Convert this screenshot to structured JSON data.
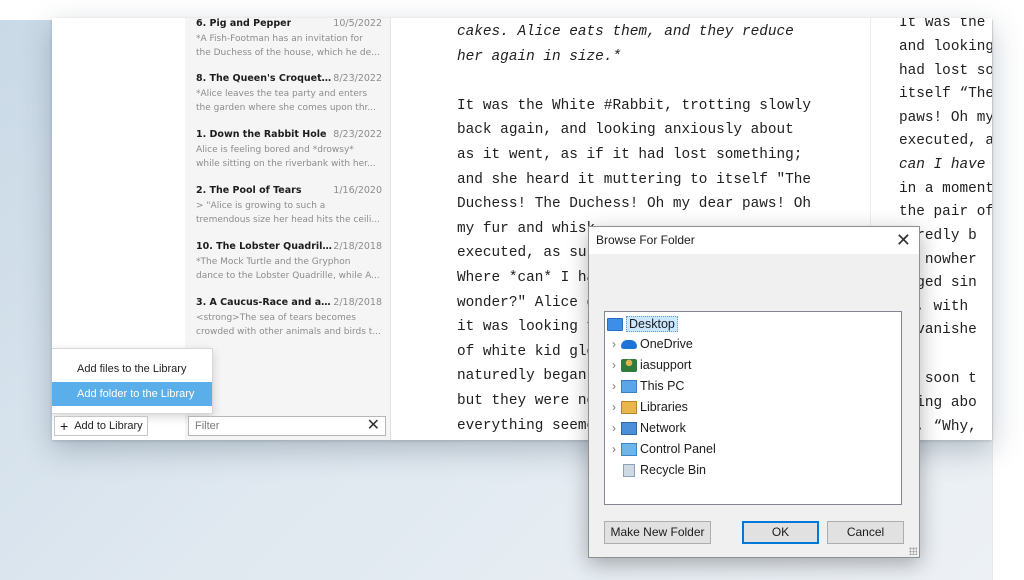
{
  "chapters": [
    {
      "title": "6. Pig and Pepper",
      "date": "10/5/2022",
      "line1": "*A Fish-Footman has an invitation for",
      "line2": "the Duchess of the house, which he del..."
    },
    {
      "title": "8. The Queen's Croquet-Gr...",
      "date": "8/23/2022",
      "line1": "*Alice leaves the tea party and enters",
      "line2": "the garden where she comes upon thr..."
    },
    {
      "title": "1. Down the Rabbit Hole",
      "date": "8/23/2022",
      "line1": "Alice is feeling bored and *drowsy*",
      "line2": "while sitting on the riverbank with her..."
    },
    {
      "title": "2. The Pool of Tears",
      "date": "1/16/2020",
      "line1": "> \"Alice is growing to such a",
      "line2": "tremendous size her head hits the ceili..."
    },
    {
      "title": "10. The Lobster Quadrille",
      "date": "2/18/2018",
      "line1": "*The Mock Turtle and the Gryphon",
      "line2": "dance to the Lobster Quadrille, while A..."
    },
    {
      "title": "3. A Caucus-Race and a Lo...",
      "date": "2/18/2018",
      "line1": "<strong>The sea of tears becomes",
      "line2": "crowded with other animals and birds t..."
    }
  ],
  "reader": {
    "lines": [
      "cakes. Alice eats them, and they reduce",
      "her again in size.*",
      "",
      "It was the White #Rabbit, trotting slowly",
      "back again, and looking anxiously about",
      "as it went, as if it had lost something;",
      "and she heard it muttering to itself \"The",
      "Duchess! The Duchess! Oh my dear paws! Oh",
      "my fur and whisk",
      "executed, as sur",
      "Where *can* I ha",
      "wonder?\" Alice g",
      "it was looking f",
      "of white kid glo",
      "naturedly began",
      "but they were no",
      "everything seeme"
    ],
    "right_lines": [
      "It was the",
      "and looking",
      "had lost so",
      "itself “The",
      "paws! Oh my",
      "executed, a",
      "can I have",
      "in a moment",
      "the pair of",
      "turedly b",
      "te nowher",
      "anged sin",
      "ll, with",
      "d vanishe",
      "",
      "ty soon t",
      "nting abo",
      "he, “Why,"
    ]
  },
  "menu": {
    "items": [
      "Add files to the Library",
      "Add folder to the Library"
    ],
    "selected_index": 1
  },
  "bottom_bar": {
    "add_button_label": "Add to Library",
    "filter_placeholder": "Filter"
  },
  "dialog": {
    "title": "Browse For Folder",
    "tree": [
      {
        "label": "Desktop",
        "icon": "desktop-icon",
        "expandable": false,
        "indent": 0,
        "selected": true
      },
      {
        "label": "OneDrive",
        "icon": "onedrive-cloud-icon",
        "expandable": true,
        "indent": 1
      },
      {
        "label": "iasupport",
        "icon": "user-folder-icon",
        "expandable": true,
        "indent": 1
      },
      {
        "label": "This PC",
        "icon": "computer-icon",
        "expandable": true,
        "indent": 1
      },
      {
        "label": "Libraries",
        "icon": "libraries-icon",
        "expandable": true,
        "indent": 1
      },
      {
        "label": "Network",
        "icon": "network-icon",
        "expandable": true,
        "indent": 1
      },
      {
        "label": "Control Panel",
        "icon": "control-panel-icon",
        "expandable": true,
        "indent": 1
      },
      {
        "label": "Recycle Bin",
        "icon": "recycle-bin-icon",
        "expandable": false,
        "indent": 1
      }
    ],
    "buttons": {
      "new_folder": "Make New Folder",
      "ok": "OK",
      "cancel": "Cancel"
    }
  },
  "colors": {
    "selection_blue": "#5aaeea",
    "tree_selection": "#cce8ff",
    "default_button_border": "#0078d7"
  }
}
